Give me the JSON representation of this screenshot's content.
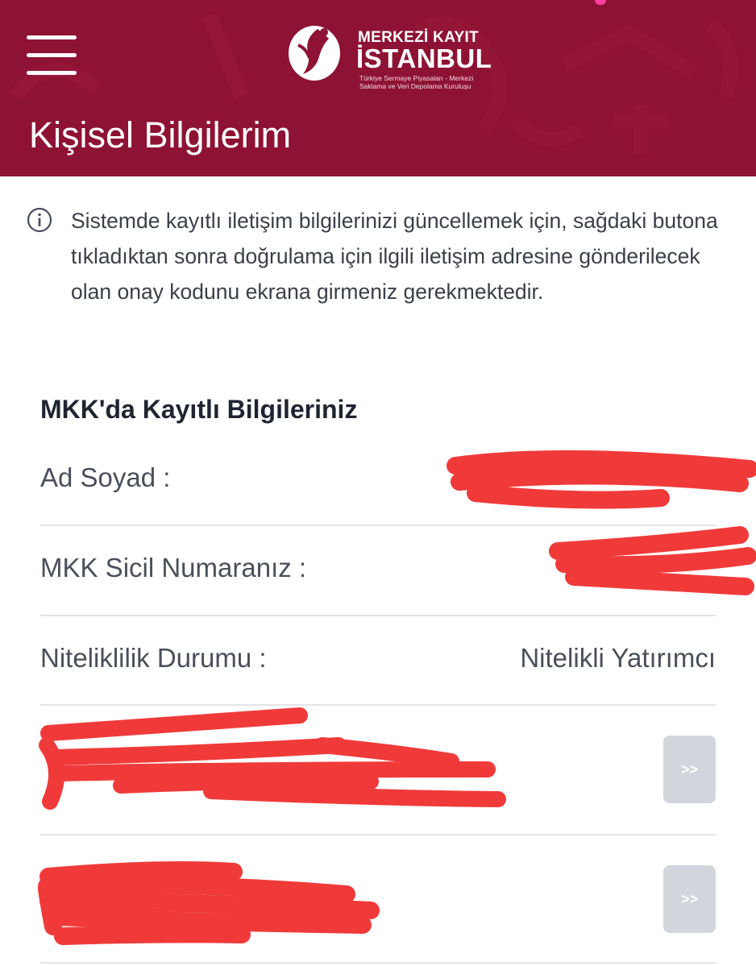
{
  "header": {
    "title": "Kişisel Bilgilerim",
    "logo": {
      "line1": "MERKEZİ KAYIT",
      "line2": "İSTANBUL",
      "tagline1": "Türkiye Sermaye Piyasaları - Merkezi",
      "tagline2": "Saklama ve Veri Depolama Kuruluşu"
    },
    "background_color": "#8e1233"
  },
  "info": {
    "text": "Sistemde kayıtlı iletişim bilgilerinizi güncellemek için, sağdaki butona tıkladıktan sonra doğrulama için ilgili iletişim adresine gönderilecek olan onay kodunu ekrana girmeniz gerekmektedir."
  },
  "section": {
    "title": "MKK'da Kayıtlı Bilgileriniz",
    "rows": [
      {
        "label": "Ad Soyad :",
        "value": ""
      },
      {
        "label": "MKK Sicil Numaranız :",
        "value": ""
      },
      {
        "label": "Niteliklilik Durumu :",
        "value": "Nitelikli Yatırımcı"
      }
    ],
    "action_rows": [
      {
        "button_label": ">>"
      },
      {
        "button_label": ">>"
      }
    ]
  },
  "icons": {
    "menu": "hamburger-menu-icon",
    "info": "info-circle-icon",
    "logo": "mkk-logo-icon"
  },
  "colors": {
    "brand": "#8e1233",
    "redaction": "#f03a3a",
    "button": "#d2d5dc"
  }
}
